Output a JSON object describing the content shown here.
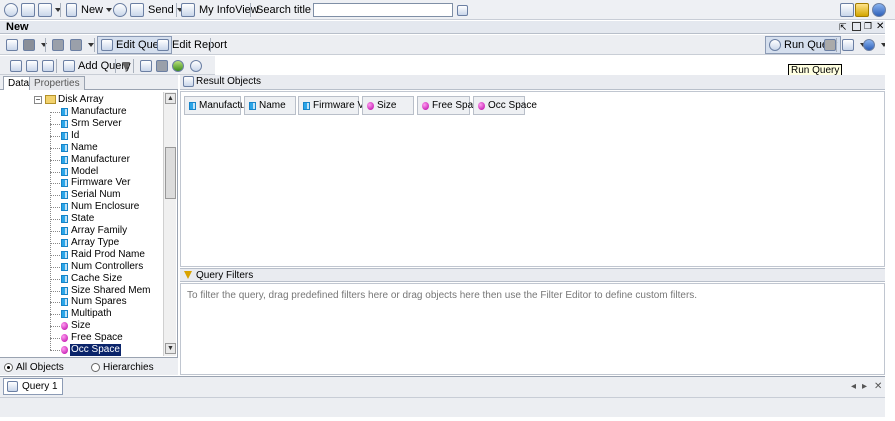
{
  "topbar": {
    "new_label": "New",
    "send_label": "Send",
    "infoview_label": "My InfoView",
    "search_label": "Search title",
    "search_value": ""
  },
  "document": {
    "title": "New"
  },
  "toolbar": {
    "edit_query_label": "Edit Query",
    "edit_report_label": "Edit Report",
    "run_query_label": "Run Query",
    "add_query_label": "Add Query",
    "tooltip": "Run Query"
  },
  "left_panel": {
    "tabs": [
      "Data",
      "Properties"
    ],
    "folder_label": "Disk Array",
    "items": [
      {
        "label": "Manufacture",
        "type": "dimension"
      },
      {
        "label": "Srm Server",
        "type": "dimension"
      },
      {
        "label": "Id",
        "type": "dimension"
      },
      {
        "label": "Name",
        "type": "dimension"
      },
      {
        "label": "Manufacturer",
        "type": "dimension"
      },
      {
        "label": "Model",
        "type": "dimension"
      },
      {
        "label": "Firmware Ver",
        "type": "dimension"
      },
      {
        "label": "Serial Num",
        "type": "dimension"
      },
      {
        "label": "Num Enclosure",
        "type": "dimension"
      },
      {
        "label": "State",
        "type": "dimension"
      },
      {
        "label": "Array Family",
        "type": "dimension"
      },
      {
        "label": "Array Type",
        "type": "dimension"
      },
      {
        "label": "Raid Prod Name",
        "type": "dimension"
      },
      {
        "label": "Num Controllers",
        "type": "dimension"
      },
      {
        "label": "Cache Size",
        "type": "dimension"
      },
      {
        "label": "Size Shared Mem",
        "type": "dimension"
      },
      {
        "label": "Num Spares",
        "type": "dimension"
      },
      {
        "label": "Multipath",
        "type": "dimension"
      },
      {
        "label": "Size",
        "type": "measure"
      },
      {
        "label": "Free Space",
        "type": "measure"
      },
      {
        "label": "Occ Space",
        "type": "measure",
        "selected": true
      }
    ],
    "radio_all": "All Objects",
    "radio_hier": "Hierarchies"
  },
  "result_objects": {
    "header": "Result Objects",
    "chips": [
      {
        "label": "Manufacture",
        "type": "dimension"
      },
      {
        "label": "Name",
        "type": "dimension"
      },
      {
        "label": "Firmware Ver",
        "type": "dimension"
      },
      {
        "label": "Size",
        "type": "measure"
      },
      {
        "label": "Free Space",
        "type": "measure"
      },
      {
        "label": "Occ Space",
        "type": "measure"
      }
    ]
  },
  "query_filters": {
    "header": "Query Filters",
    "hint": "To filter the query, drag predefined filters here or drag objects here then use the Filter Editor to define custom filters."
  },
  "query_tabs": [
    {
      "label": "Query 1"
    }
  ],
  "nav": {
    "prev": "◂",
    "next": "▸",
    "close": "✕"
  },
  "scroll": {
    "up": "▲",
    "down": "▼"
  },
  "expander": "−",
  "colors": {
    "dimension": "#2aa5e8",
    "measure": "#c800b4",
    "selection": "#0a246a"
  }
}
